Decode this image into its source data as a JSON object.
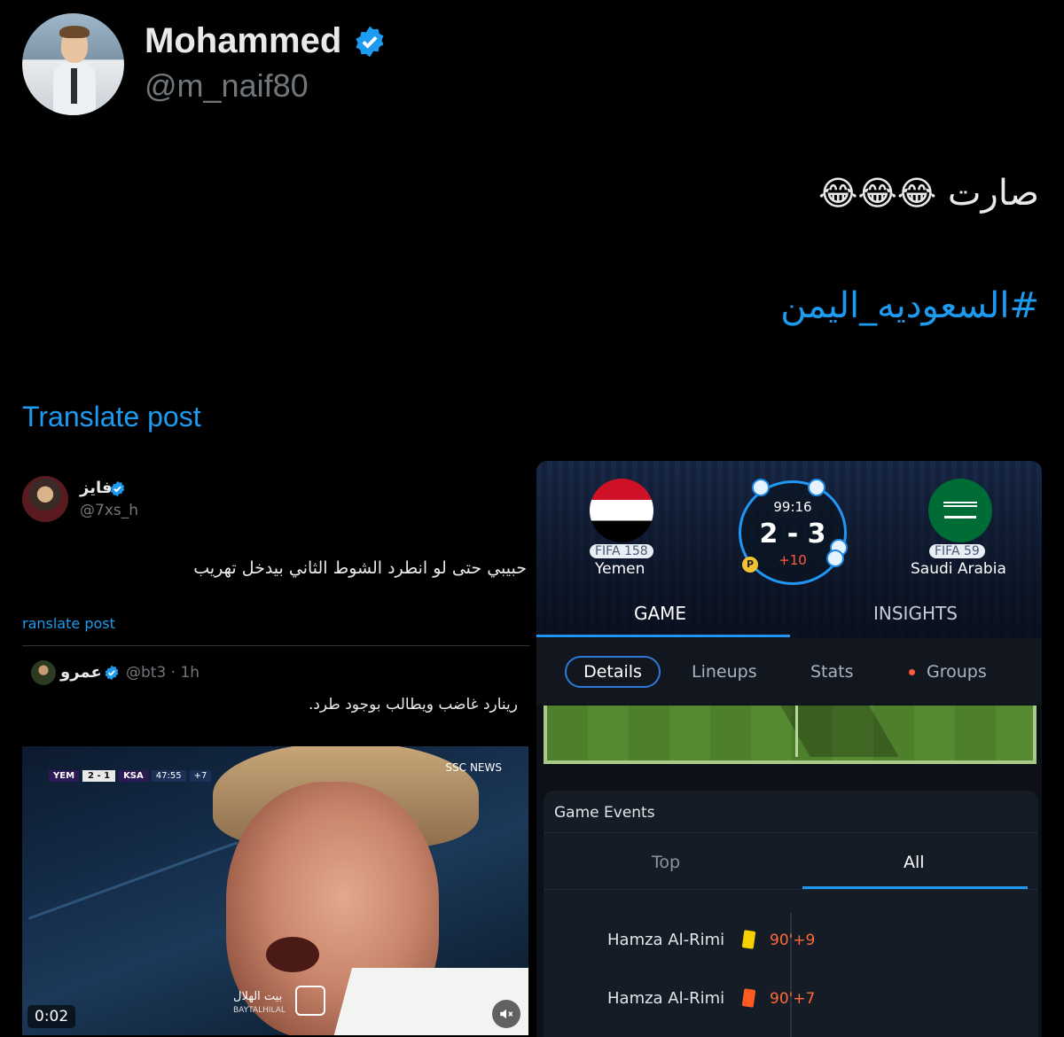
{
  "author": {
    "name": "Mohammed",
    "handle": "@m_naif80"
  },
  "tweet": {
    "text": "صارت",
    "emoji": "😂😂😂",
    "hashtag": "#السعوديه_اليمن",
    "translate_label": "Translate post"
  },
  "embedded_post": {
    "author_name": "فايز",
    "author_handle": "@7xs_h",
    "text": "حبيبي حتى لو انطرد الشوط الثاني بيدخل تهريب",
    "translate_label": "ranslate post",
    "quote": {
      "author_name": "عمرو",
      "author_handle": "@bt3 · 1h",
      "text": "رينارد غاضب ويطالب بوجود طرد."
    },
    "video": {
      "scorebug": {
        "home": "YEM",
        "score": "2 - 1",
        "away": "KSA",
        "clock": "47:55",
        "added": "+7"
      },
      "channel_brand": "SSC",
      "channel_sub": "NEWS",
      "channel_ar": "بيت الهلال",
      "channel_en": "BAYTALHILAL",
      "timer": "0:02"
    }
  },
  "app": {
    "match": {
      "home_team": "Yemen",
      "home_rank": "FIFA 158",
      "away_team": "Saudi Arabia",
      "away_rank": "FIFA 59",
      "clock": "99:16",
      "score": "2 - 3",
      "added_time": "+10",
      "badge": "P"
    },
    "main_tabs": [
      "GAME",
      "INSIGHTS"
    ],
    "sub_tabs": [
      "Details",
      "Lineups",
      "Stats",
      "Groups"
    ],
    "events": {
      "title": "Game Events",
      "tabs": [
        "Top",
        "All"
      ],
      "items": [
        {
          "player": "Hamza Al-Rimi",
          "card": "yellow",
          "time": "90'+9"
        },
        {
          "player": "Hamza Al-Rimi",
          "card": "red",
          "time": "90'+7"
        }
      ]
    }
  },
  "colors": {
    "accent": "#1d9bf0",
    "app_accent": "#2196f3",
    "event_time": "#ff6a3a"
  }
}
